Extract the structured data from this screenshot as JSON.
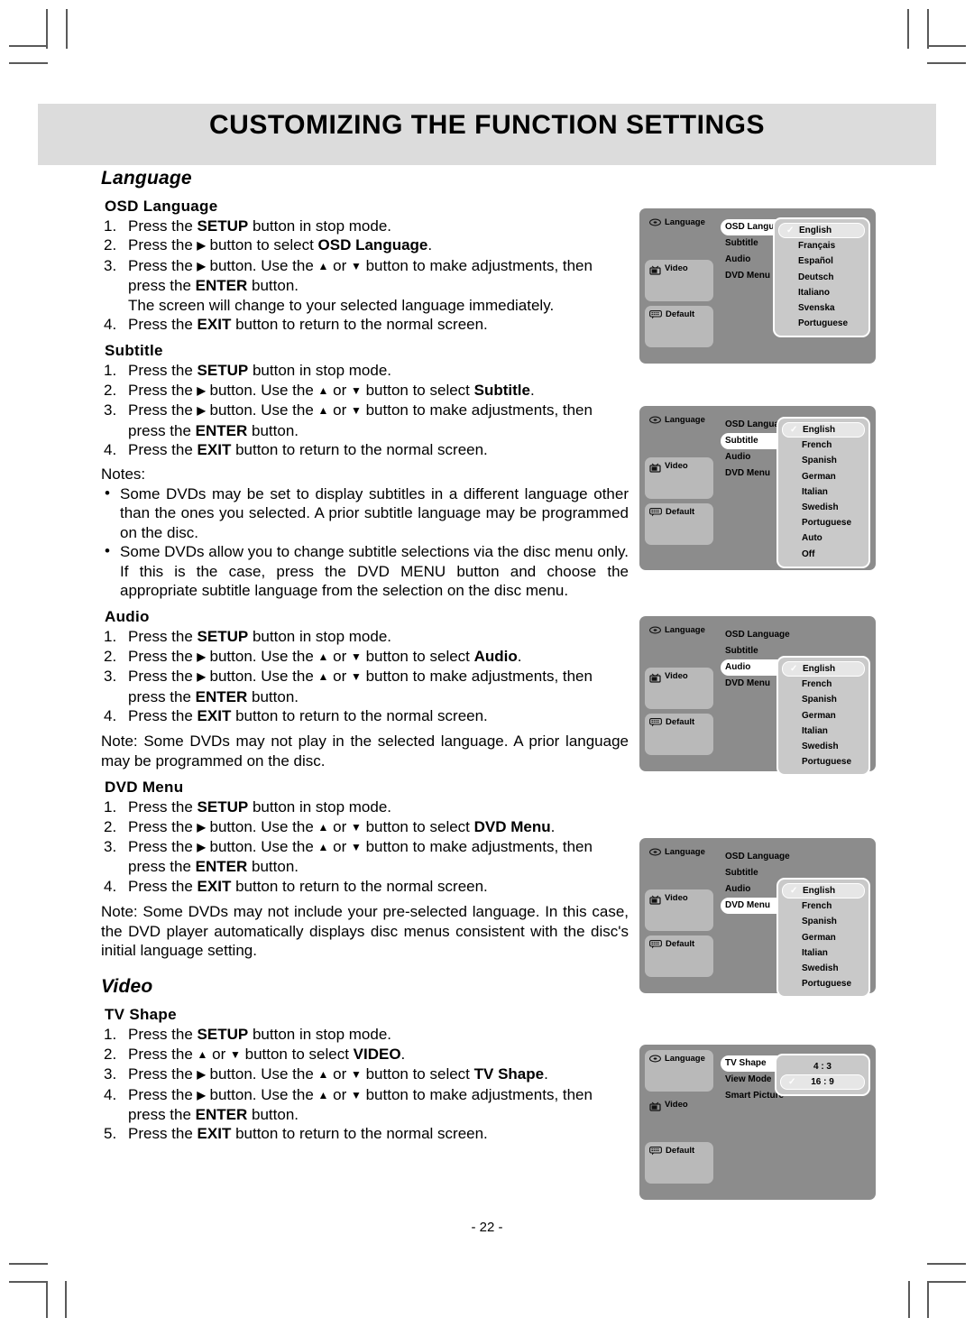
{
  "header": {
    "title": "CUSTOMIZING THE FUNCTION SETTINGS"
  },
  "footer": {
    "page_number": "- 22 -"
  },
  "sections": {
    "language_heading": "Language",
    "video_heading": "Video",
    "osd_language": {
      "heading": "OSD Language",
      "steps": [
        {
          "num": "1.",
          "html": "Press the <b>SETUP</b> button in stop mode."
        },
        {
          "num": "2.",
          "html": "Press the <b class=\"ar\">▶</b> button to select <b>OSD Language</b>."
        },
        {
          "num": "3.",
          "html": "Press the <b class=\"ar\">▶</b> button. Use the <b class=\"ar\">▲</b> or <b class=\"ar\">▼</b> button to make adjustments, then press the <b>ENTER</b> button."
        }
      ],
      "extra_line": "The screen will change to your selected language immediately.",
      "last_step": {
        "num": "4.",
        "html": "Press the <b>EXIT</b> button to return to the normal screen."
      }
    },
    "subtitle": {
      "heading": "Subtitle",
      "steps": [
        {
          "num": "1.",
          "html": "Press the <b>SETUP</b> button in stop mode."
        },
        {
          "num": "2.",
          "html": "Press the <b class=\"ar\">▶</b> button. Use the <b class=\"ar\">▲</b> or <b class=\"ar\">▼</b> button to select <b>Subtitle</b>."
        },
        {
          "num": "3.",
          "html": "Press the <b class=\"ar\">▶</b> button. Use the <b class=\"ar\">▲</b> or <b class=\"ar\">▼</b> button to make adjustments, then press the <b>ENTER</b> button."
        },
        {
          "num": "4.",
          "html": "Press the <b>EXIT</b> button to return to the normal screen."
        }
      ],
      "notes_label": "Notes:",
      "notes": [
        "Some DVDs may be set to display subtitles in a different language other than the ones you selected. A prior subtitle language may be programmed on the disc.",
        "Some DVDs allow you to change subtitle selections via the disc menu only. If this is the case, press the DVD MENU button and choose the appropriate subtitle language from the selection on the disc menu."
      ]
    },
    "audio": {
      "heading": "Audio",
      "steps": [
        {
          "num": "1.",
          "html": "Press the <b>SETUP</b> button in stop mode."
        },
        {
          "num": "2.",
          "html": "Press the <b class=\"ar\">▶</b> button. Use the <b class=\"ar\">▲</b> or <b class=\"ar\">▼</b> button to select <b>Audio</b>."
        },
        {
          "num": "3.",
          "html": "Press the <b class=\"ar\">▶</b> button. Use the <b class=\"ar\">▲</b> or <b class=\"ar\">▼</b> button to make adjustments, then press the <b>ENTER</b> button."
        },
        {
          "num": "4.",
          "html": "Press the <b>EXIT</b> button to return to the normal screen."
        }
      ],
      "note": "Note: Some DVDs may not play in the selected language. A prior language may be programmed on the disc."
    },
    "dvd_menu": {
      "heading": "DVD Menu",
      "steps": [
        {
          "num": "1.",
          "html": "Press the <b>SETUP</b> button in stop mode."
        },
        {
          "num": "2.",
          "html": "Press the <b class=\"ar\">▶</b> button. Use the <b class=\"ar\">▲</b> or <b class=\"ar\">▼</b> button to select <b>DVD Menu</b>."
        },
        {
          "num": "3.",
          "html": "Press the <b class=\"ar\">▶</b> button. Use the <b class=\"ar\">▲</b> or <b class=\"ar\">▼</b> button to make adjustments, then press the <b>ENTER</b> button."
        },
        {
          "num": "4.",
          "html": "Press the <b>EXIT</b> button to return to the normal screen."
        }
      ],
      "note": "Note: Some DVDs may not include your pre-selected language. In this case, the DVD player automatically displays disc menus consistent with the disc's initial language setting."
    },
    "tv_shape": {
      "heading": "TV Shape",
      "steps": [
        {
          "num": "1.",
          "html": "Press the <b>SETUP</b> button in stop mode."
        },
        {
          "num": "2.",
          "html": "Press the <b class=\"ar\">▲</b> or <b class=\"ar\">▼</b> button to select <b>VIDEO</b>."
        },
        {
          "num": "3.",
          "html": "Press the <b class=\"ar\">▶</b> button. Use the <b class=\"ar\">▲</b> or <b class=\"ar\">▼</b> button to select <b>TV Shape</b>."
        },
        {
          "num": "4.",
          "html": "Press the <b class=\"ar\">▶</b> button. Use the <b class=\"ar\">▲</b> or <b class=\"ar\">▼</b> button to make adjustments, then press the <b>ENTER</b> button."
        },
        {
          "num": "5.",
          "html": "Press the <b>EXIT</b> button to return to the normal screen."
        }
      ]
    }
  },
  "osd_screens": [
    {
      "id": "osd-language",
      "sidebar": [
        {
          "label": "Language",
          "icon": "disc-icon",
          "active": true
        },
        {
          "label": "Video",
          "icon": "tv-icon",
          "active": false
        },
        {
          "label": "Default",
          "icon": "default-icon",
          "active": false
        }
      ],
      "menu": [
        {
          "label": "OSD Language",
          "selected": true
        },
        {
          "label": "Subtitle",
          "selected": false
        },
        {
          "label": "Audio",
          "selected": false
        },
        {
          "label": "DVD Menu",
          "selected": false
        }
      ],
      "options": [
        {
          "label": "English",
          "checked": true
        },
        {
          "label": "Français",
          "checked": false
        },
        {
          "label": "Español",
          "checked": false
        },
        {
          "label": "Deutsch",
          "checked": false
        },
        {
          "label": "Italiano",
          "checked": false
        },
        {
          "label": "Svenska",
          "checked": false
        },
        {
          "label": "Portuguese",
          "checked": false
        }
      ]
    },
    {
      "id": "osd-subtitle",
      "sidebar": [
        {
          "label": "Language",
          "icon": "disc-icon",
          "active": true
        },
        {
          "label": "Video",
          "icon": "tv-icon",
          "active": false
        },
        {
          "label": "Default",
          "icon": "default-icon",
          "active": false
        }
      ],
      "menu": [
        {
          "label": "OSD Language",
          "selected": false
        },
        {
          "label": "Subtitle",
          "selected": true
        },
        {
          "label": "Audio",
          "selected": false
        },
        {
          "label": "DVD Menu",
          "selected": false
        }
      ],
      "options": [
        {
          "label": "English",
          "checked": true
        },
        {
          "label": "French",
          "checked": false
        },
        {
          "label": "Spanish",
          "checked": false
        },
        {
          "label": "German",
          "checked": false
        },
        {
          "label": "Italian",
          "checked": false
        },
        {
          "label": "Swedish",
          "checked": false
        },
        {
          "label": "Portuguese",
          "checked": false
        },
        {
          "label": "Auto",
          "checked": false
        },
        {
          "label": "Off",
          "checked": false
        }
      ]
    },
    {
      "id": "osd-audio",
      "sidebar": [
        {
          "label": "Language",
          "icon": "disc-icon",
          "active": true
        },
        {
          "label": "Video",
          "icon": "tv-icon",
          "active": false
        },
        {
          "label": "Default",
          "icon": "default-icon",
          "active": false
        }
      ],
      "menu": [
        {
          "label": "OSD Language",
          "selected": false
        },
        {
          "label": "Subtitle",
          "selected": false
        },
        {
          "label": "Audio",
          "selected": true
        },
        {
          "label": "DVD Menu",
          "selected": false
        }
      ],
      "options": [
        {
          "label": "English",
          "checked": true
        },
        {
          "label": "French",
          "checked": false
        },
        {
          "label": "Spanish",
          "checked": false
        },
        {
          "label": "German",
          "checked": false
        },
        {
          "label": "Italian",
          "checked": false
        },
        {
          "label": "Swedish",
          "checked": false
        },
        {
          "label": "Portuguese",
          "checked": false
        }
      ]
    },
    {
      "id": "osd-dvdmenu",
      "sidebar": [
        {
          "label": "Language",
          "icon": "disc-icon",
          "active": true
        },
        {
          "label": "Video",
          "icon": "tv-icon",
          "active": false
        },
        {
          "label": "Default",
          "icon": "default-icon",
          "active": false
        }
      ],
      "menu": [
        {
          "label": "OSD Language",
          "selected": false
        },
        {
          "label": "Subtitle",
          "selected": false
        },
        {
          "label": "Audio",
          "selected": false
        },
        {
          "label": "DVD Menu",
          "selected": true
        }
      ],
      "options": [
        {
          "label": "English",
          "checked": true
        },
        {
          "label": "French",
          "checked": false
        },
        {
          "label": "Spanish",
          "checked": false
        },
        {
          "label": "German",
          "checked": false
        },
        {
          "label": "Italian",
          "checked": false
        },
        {
          "label": "Swedish",
          "checked": false
        },
        {
          "label": "Portuguese",
          "checked": false
        }
      ]
    },
    {
      "id": "osd-tvshape",
      "sidebar": [
        {
          "label": "Language",
          "icon": "disc-icon",
          "active": false
        },
        {
          "label": "Video",
          "icon": "tv-icon",
          "active": true
        },
        {
          "label": "Default",
          "icon": "default-icon",
          "active": false
        }
      ],
      "menu": [
        {
          "label": "TV Shape",
          "selected": true
        },
        {
          "label": "View Mode",
          "selected": false
        },
        {
          "label": "Smart Picture",
          "selected": false
        }
      ],
      "options": [
        {
          "label": "4 : 3",
          "checked": false
        },
        {
          "label": "16 : 9",
          "checked": true
        }
      ]
    }
  ],
  "colors": {
    "header_band": "#dcdcdc",
    "osd_background": "#8c8c8c",
    "osd_sidebar": "#b9b9b9",
    "osd_optionbox": "#c9c9c9",
    "osd_selected": "#ffffff"
  }
}
